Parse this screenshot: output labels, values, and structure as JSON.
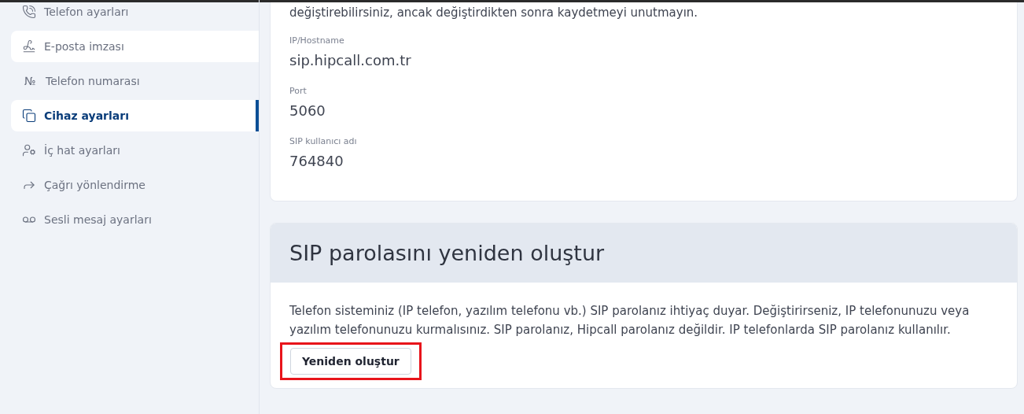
{
  "sidebar": {
    "items": [
      {
        "label": "Telefon ayarları",
        "selected": false,
        "hovered": false
      },
      {
        "label": "E-posta imzası",
        "selected": false,
        "hovered": true
      },
      {
        "label": "Telefon numarası",
        "selected": false,
        "hovered": false,
        "icon_text": "№"
      },
      {
        "label": "Cihaz ayarları",
        "selected": true,
        "hovered": false
      },
      {
        "label": "İç hat ayarları",
        "selected": false,
        "hovered": false
      },
      {
        "label": "Çağrı yönlendirme",
        "selected": false,
        "hovered": false
      },
      {
        "label": "Sesli mesaj ayarları",
        "selected": false,
        "hovered": false
      }
    ]
  },
  "sip_card": {
    "intro": "değiştirebilirsiniz, ancak değiştirdikten sonra kaydetmeyi unutmayın.",
    "fields": [
      {
        "label": "IP/Hostname",
        "value": "sip.hipcall.com.tr"
      },
      {
        "label": "Port",
        "value": "5060"
      },
      {
        "label": "SIP kullanıcı adı",
        "value": "764840"
      }
    ]
  },
  "regenerate_card": {
    "title": "SIP parolasını yeniden oluştur",
    "description": "Telefon sisteminiz (IP telefon, yazılım telefonu vb.) SIP parolanız ihtiyaç duyar. Değiştirirseniz, IP telefonunuzu veya yazılım telefonunuzu kurmalısınız. SIP parolanız, Hipcall parolanız değildir. IP telefonlarda SIP parolanız kullanılır.",
    "button": {
      "label": "Yeniden oluştur",
      "highlighted": true
    }
  }
}
